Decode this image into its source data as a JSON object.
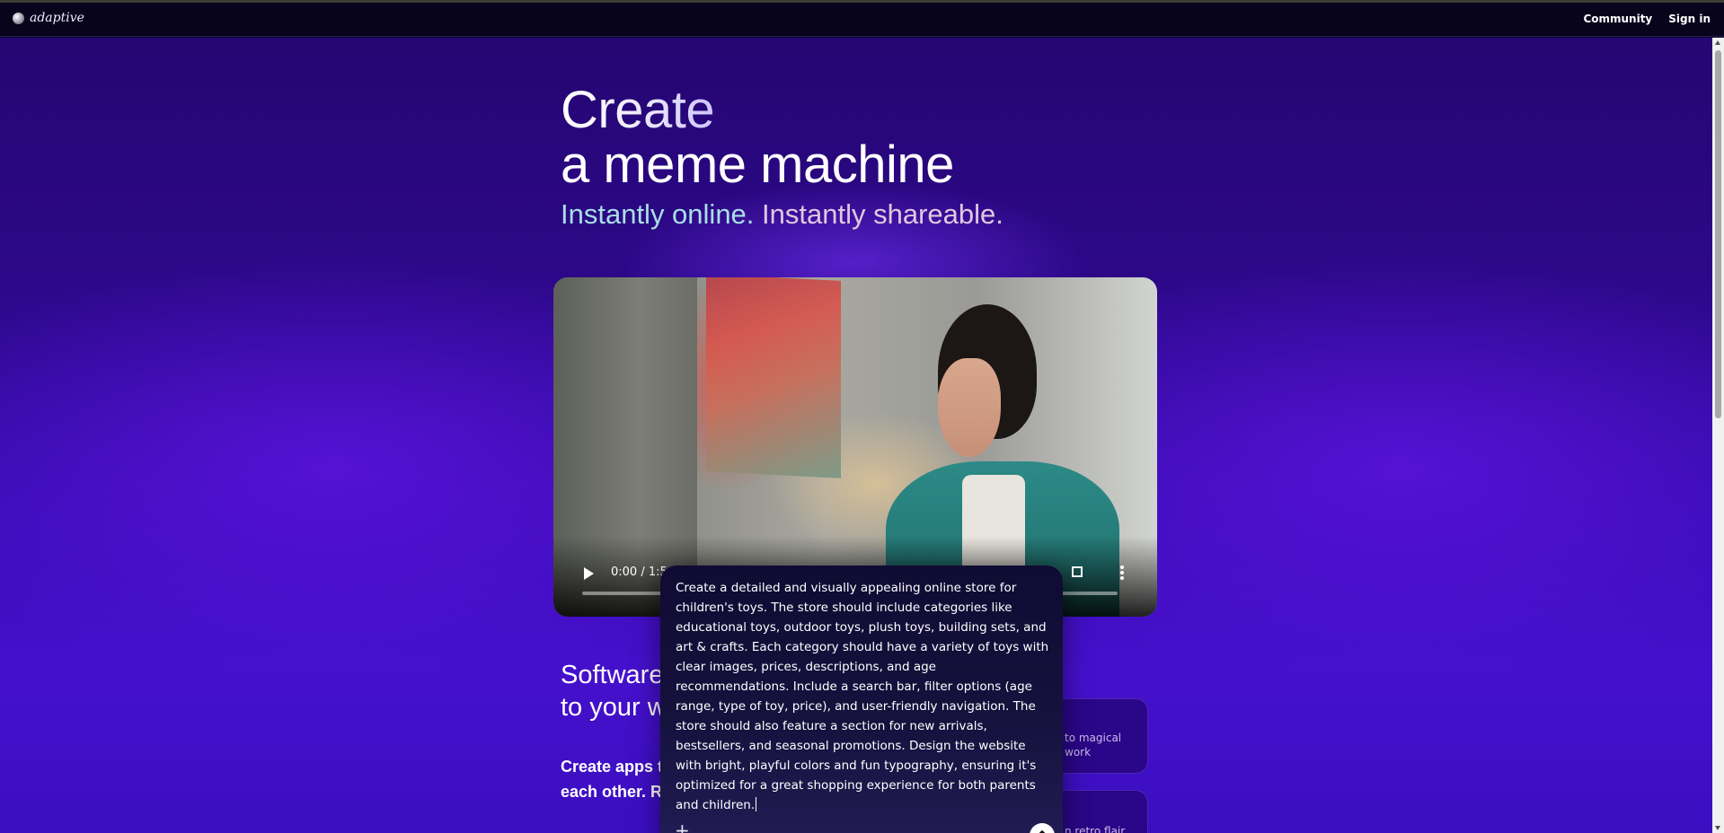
{
  "nav": {
    "logo_text": "adaptive",
    "links": [
      "Community",
      "Sign in"
    ]
  },
  "hero": {
    "title_line1": "Create",
    "title_line2": "a meme machine",
    "subtitle_part1": "Instantly online.",
    "subtitle_part2": "Instantly shareable."
  },
  "video": {
    "time": "0:00 / 1:5"
  },
  "section": {
    "title_line1": "Software",
    "title_line2": "to your w",
    "body_line1": "Create apps th",
    "body_line2": "each other. Re"
  },
  "cards": [
    {
      "line1": "to magical",
      "line2": "work"
    },
    {
      "line1": "n retro flair"
    }
  ],
  "prompt": {
    "text": "Create a detailed and visually appealing online store for children's toys. The store should include categories like educational toys, outdoor toys, plush toys, building sets, and art & crafts. Each category should have a variety of toys with clear images, prices, descriptions, and age recommendations. Include a search bar, filter options (age range, type of toy, price), and user-friendly navigation. The store should also feature a section for new arrivals, bestsellers, and seasonal promotions. Design the website with bright, playful colors and fun typography, ensuring it's optimized for a great shopping experience for both parents and children.",
    "add_symbol": "+"
  },
  "colors": {
    "background_top": "#250672",
    "background_bottom": "#4510cc",
    "prompt_bg": "#16123e",
    "nav_bg": "#08041c"
  },
  "icons": {
    "logo": "adaptive-logo-icon",
    "play": "play-icon",
    "fullscreen": "fullscreen-icon",
    "more": "more-vertical-icon",
    "add": "plus-icon",
    "send": "arrow-up-icon"
  }
}
